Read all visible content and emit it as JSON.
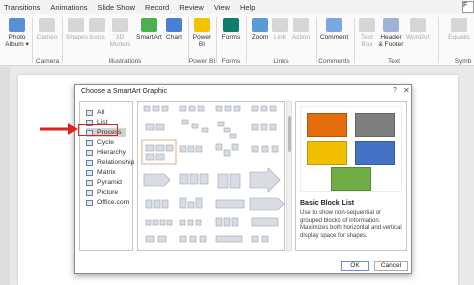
{
  "tabs": [
    "Transitions",
    "Animations",
    "Slide Show",
    "Record",
    "Review",
    "View",
    "Help"
  ],
  "tabs_right": "F",
  "ribbon": {
    "buttons": {
      "photo_album": "Photo Album ▾",
      "cameo": "Cameo",
      "shapes": "Shapes",
      "icons": "Icons",
      "models3d": "3D Models",
      "smartart": "SmartArt",
      "chart": "Chart",
      "powerbi": "Power BI",
      "forms": "Forms",
      "zoom": "Zoom",
      "link": "Link",
      "action": "Action",
      "comment": "Comment",
      "textbox": "Text Box",
      "header_footer": "Header & Footer",
      "wordart": "WordArt",
      "equation": "Equatic"
    },
    "groups": {
      "camera": "Camera",
      "illustrations": "Illustrations",
      "powerbi": "Power BI",
      "forms": "Forms",
      "links": "Links",
      "comments": "Comments",
      "text": "Text",
      "symbols": "Symb"
    }
  },
  "dialog": {
    "title": "Choose a SmartArt Graphic",
    "help": "?",
    "close": "✕",
    "categories": [
      "All",
      "List",
      "Process",
      "Cycle",
      "Hierarchy",
      "Relationship",
      "Matrix",
      "Pyramid",
      "Picture",
      "Office.com"
    ],
    "selected_category": "Process",
    "preview_name": "Basic Block List",
    "preview_description": "Use to show non-sequential or grouped blocks of information. Maximizes both horizontal and vertical display space for shapes.",
    "ok": "OK",
    "cancel": "Cancel",
    "preview_colors": [
      "#e46c0a",
      "#7f7f7f",
      "#f2c000",
      "#4472c4",
      "#70ad47"
    ]
  },
  "colors": {
    "highlight": "#dd2222",
    "accent": "#4472c4"
  }
}
